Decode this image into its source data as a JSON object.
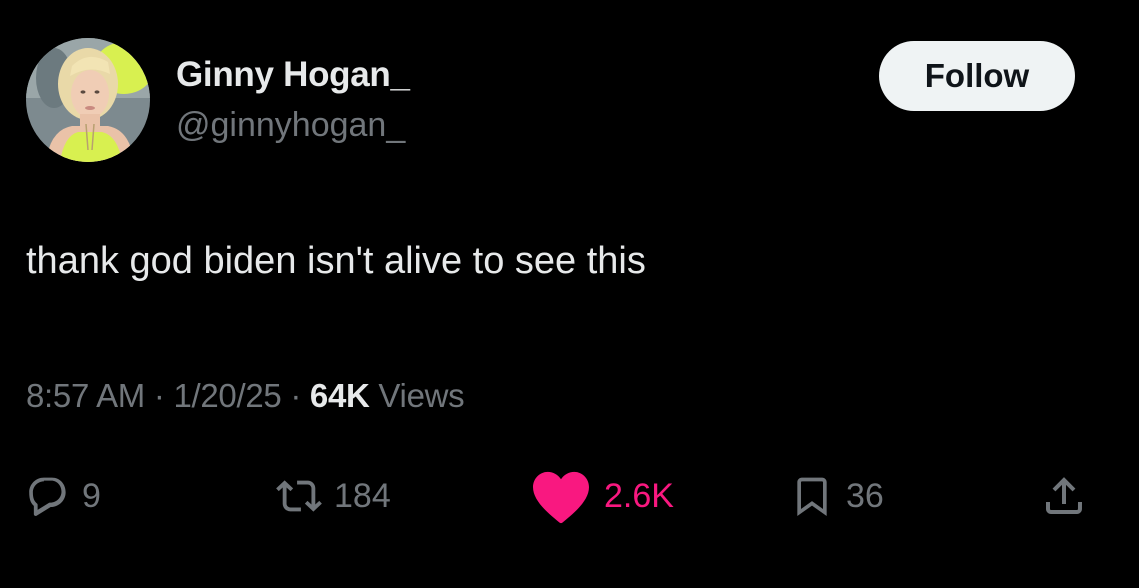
{
  "author": {
    "display_name": "Ginny Hogan_",
    "handle": "@ginnyhogan_",
    "avatar_icon": "profile-photo-avatar"
  },
  "follow_label": "Follow",
  "tweet": {
    "text": "thank god biden isn't alive to see this"
  },
  "meta": {
    "time": "8:57 AM",
    "separator": "·",
    "date": "1/20/25",
    "views_count": "64K",
    "views_label": "Views"
  },
  "actions": {
    "reply": {
      "icon": "reply-icon",
      "count": "9"
    },
    "retweet": {
      "icon": "retweet-icon",
      "count": "184"
    },
    "like": {
      "icon": "heart-icon",
      "count": "2.6K",
      "color": "#f91880"
    },
    "bookmark": {
      "icon": "bookmark-icon",
      "count": "36"
    },
    "share": {
      "icon": "share-icon"
    }
  },
  "colors": {
    "background": "#000000",
    "primary_text": "#e7e9ea",
    "secondary_text": "#71767b",
    "like_pink": "#f91880",
    "follow_bg": "#eff3f4"
  }
}
